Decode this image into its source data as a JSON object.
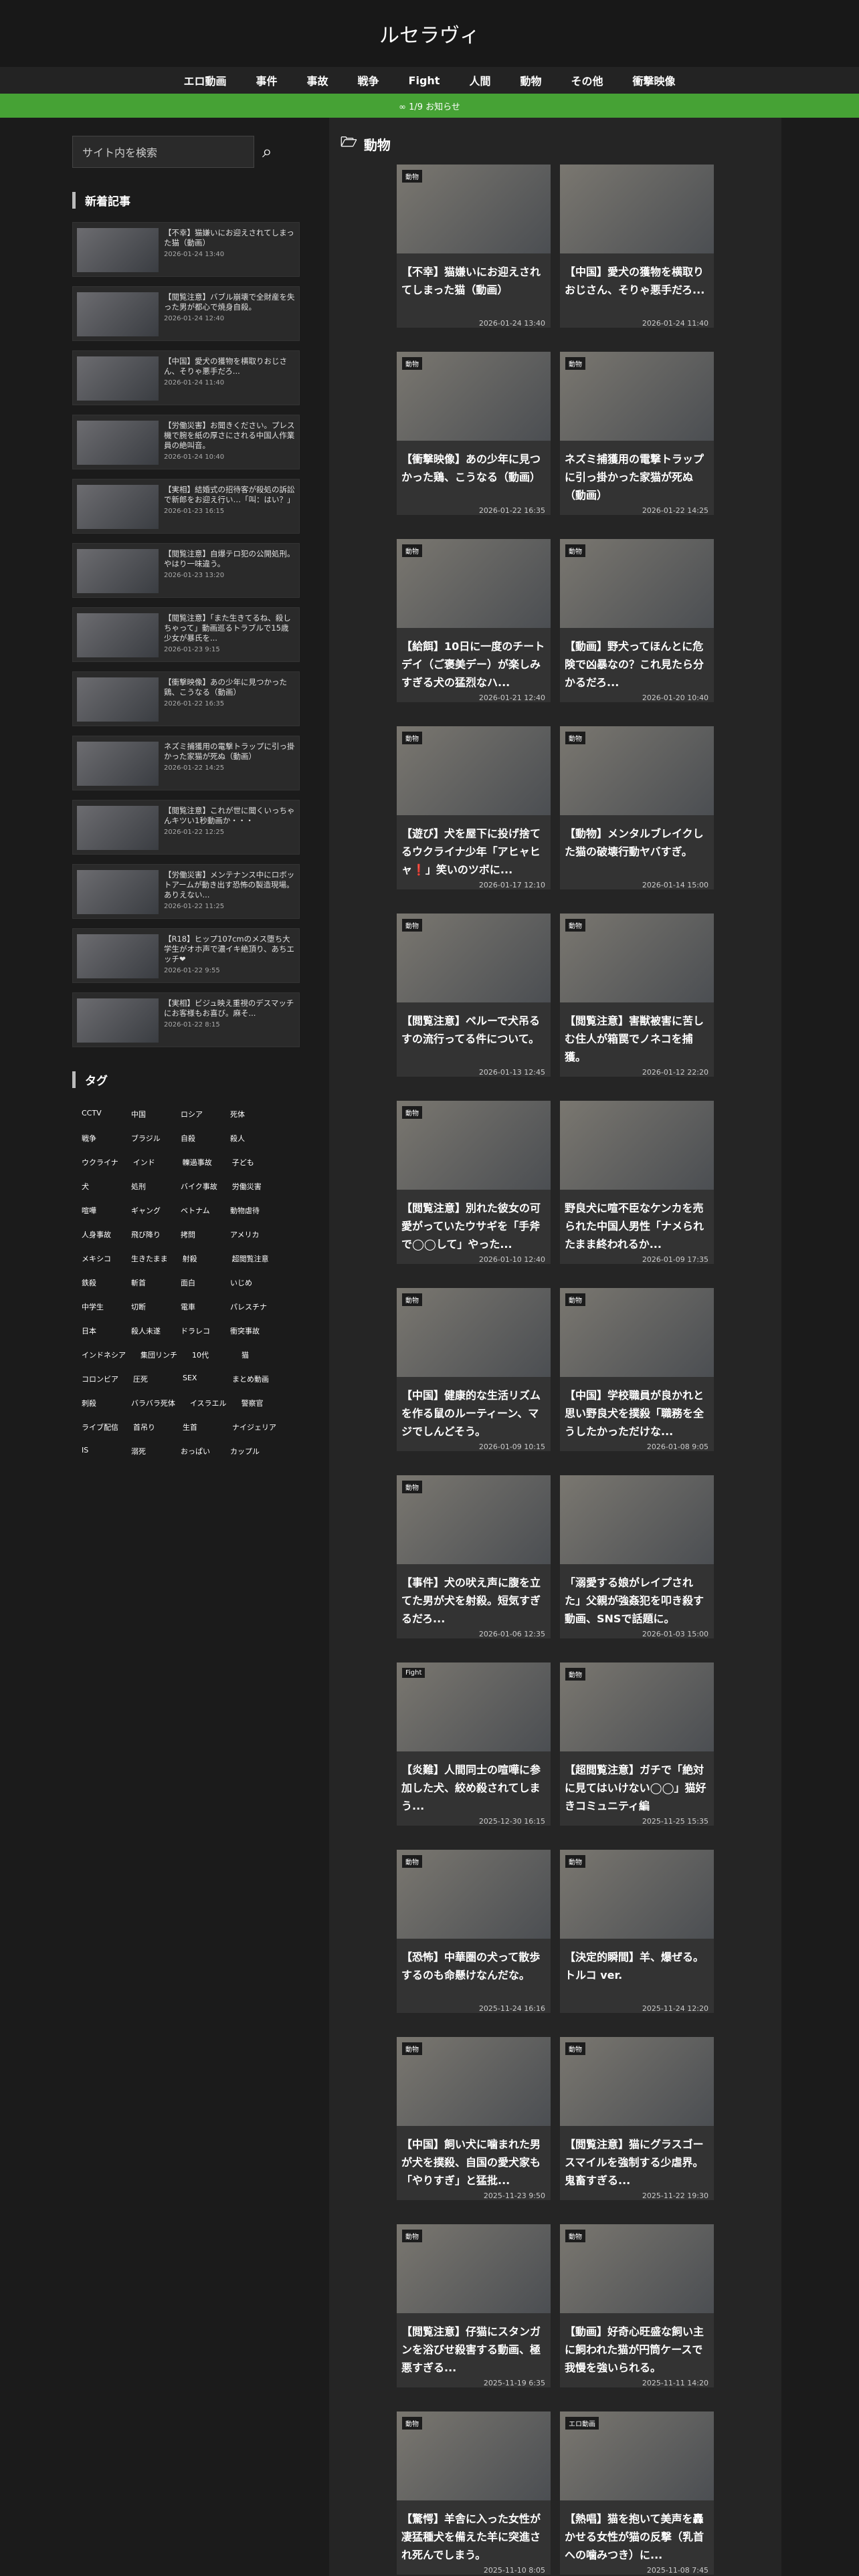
{
  "site": {
    "title": "ルセラヴィ"
  },
  "nav": [
    "エロ動画",
    "事件",
    "事故",
    "戦争",
    "Fight",
    "人間",
    "動物",
    "その他",
    "衝撃映像"
  ],
  "notice": "∞ 1/9 お知らせ",
  "search": {
    "placeholder": "サイト内を検索"
  },
  "sidebar": {
    "recent_heading": "新着記事",
    "tags_heading": "タグ",
    "articles": [
      {
        "t": "【不幸】猫嫌いにお迎えされてしまった猫（動画）",
        "d": "2026-01-24 13:40"
      },
      {
        "t": "【閲覧注意】バブル崩壊で全財産を失った男が都心で焼身自殺。",
        "d": "2026-01-24 12:40"
      },
      {
        "t": "【中国】愛犬の獲物を横取りおじさん、そりゃ悪手だろ...",
        "d": "2026-01-24 11:40"
      },
      {
        "t": "【労働災害】お聞きください。プレス機で腕を紙の厚さにされる中国人作業員の絶叫音。",
        "d": "2026-01-24 10:40"
      },
      {
        "t": "【実相】結婚式の招待客が殺処の訴訟で新郎をお迎え行い…「叫：はい？」",
        "d": "2026-01-23 16:15"
      },
      {
        "t": "【閲覧注意】自爆テロ犯の公開処刑。やはり一味違う。",
        "d": "2026-01-23 13:20"
      },
      {
        "t": "【閲覧注意】「また生きてるね、殺しちゃって」動画巡るトラブルで15歳少女が暴氏を...",
        "d": "2026-01-23 9:15"
      },
      {
        "t": "【衝撃映像】あの少年に見つかった鶏、こうなる（動画）",
        "d": "2026-01-22 16:35"
      },
      {
        "t": "ネズミ捕獲用の電撃トラップに引っ掛かった家猫が死ぬ（動画）",
        "d": "2026-01-22 14:25"
      },
      {
        "t": "【閲覧注意】これが世に聞くいっちゃんキツい1秒動画か・・・",
        "d": "2026-01-22 12:25"
      },
      {
        "t": "【労働災害】メンテナンス中にロボットアームが動き出す恐怖の製造現場。ありえない...",
        "d": "2026-01-22 11:25"
      },
      {
        "t": "【R18】ヒップ107cmのメス堕ち大学生がオホ声で濃イキ絶頂り、あちエッチ❤",
        "d": "2026-01-22 9:55"
      },
      {
        "t": "【実相】ビジュ映え重視のデスマッチにお客様もお喜び。麻そ...",
        "d": "2026-01-22 8:15"
      }
    ],
    "tags": [
      "CCTV",
      "中国",
      "ロシア",
      "死体",
      "戦争",
      "ブラジル",
      "自殺",
      "殺人",
      "ウクライナ",
      "インド",
      "轢過事故",
      "子ども",
      "犬",
      "処刑",
      "バイク事故",
      "労働災害",
      "喧嘩",
      "ギャング",
      "ベトナム",
      "動物虐待",
      "人身事故",
      "飛び降り",
      "拷問",
      "アメリカ",
      "メキシコ",
      "生きたまま",
      "射殺",
      "超閲覧注意",
      "鉄殺",
      "斬首",
      "面白",
      "いじめ",
      "中学生",
      "切断",
      "電車",
      "パレスチナ",
      "日本",
      "殺人未遂",
      "ドラレコ",
      "衝突事故",
      "インドネシア",
      "集団リンチ",
      "10代",
      "猫",
      "コロンビア",
      "圧死",
      "SEX",
      "まとめ動画",
      "刺殺",
      "バラバラ死体",
      "イスラエル",
      "警察官",
      "ライブ配信",
      "首吊り",
      "生首",
      "ナイジェリア",
      "IS",
      "溺死",
      "おっぱい",
      "カップル"
    ]
  },
  "main": {
    "heading": "動物",
    "cards": [
      {
        "c": "動物",
        "t": "【不幸】猫嫌いにお迎えされてしまった猫（動画）",
        "d": "2026-01-24 13:40"
      },
      {
        "c": "",
        "t": "【中国】愛犬の獲物を横取りおじさん、そりゃ悪手だろ...",
        "d": "2026-01-24 11:40"
      },
      {
        "c": "動物",
        "t": "【衝撃映像】あの少年に見つかった鶏、こうなる（動画）",
        "d": "2026-01-22 16:35"
      },
      {
        "c": "動物",
        "t": "ネズミ捕獲用の電撃トラップに引っ掛かった家猫が死ぬ（動画）",
        "d": "2026-01-22 14:25"
      },
      {
        "c": "動物",
        "t": "【給餌】10日に一度のチートデイ（ご褒美デー）が楽しみすぎる犬の猛烈なハ...",
        "d": "2026-01-21 12:40"
      },
      {
        "c": "動物",
        "t": "【動画】野犬ってほんとに危険で凶暴なの？これ見たら分かるだろ...",
        "d": "2026-01-20 10:40"
      },
      {
        "c": "動物",
        "t": "【遊び】犬を屋下に投げ捨てるウクライナ少年「アヒャヒャ❗」笑いのツボに...",
        "d": "2026-01-17 12:10"
      },
      {
        "c": "動物",
        "t": "【動物】メンタルブレイクした猫の破壊行動ヤバすぎ。",
        "d": "2026-01-14 15:00"
      },
      {
        "c": "動物",
        "t": "【閲覧注意】ペルーで犬吊るすの流行ってる件について。",
        "d": "2026-01-13 12:45"
      },
      {
        "c": "動物",
        "t": "【閲覧注意】害獣被害に苦しむ住人が箱罠でノネコを捕獲。",
        "d": "2026-01-12 22:20"
      },
      {
        "c": "動物",
        "t": "【閲覧注意】別れた彼女の可愛がっていたウサギを「手斧で◯◯して」やった...",
        "d": "2026-01-10 12:40"
      },
      {
        "c": "",
        "t": "野良犬に喧不臣なケンカを売られた中国人男性「ナメられたまま終われるか...",
        "d": "2026-01-09 17:35"
      },
      {
        "c": "動物",
        "t": "【中国】健康的な生活リズムを作る鼠のルーティーン、マジでしんどそう。",
        "d": "2026-01-09 10:15"
      },
      {
        "c": "動物",
        "t": "【中国】学校職員が良かれと思い野良犬を撲殺「職務を全うしたかっただけな...",
        "d": "2026-01-08 9:05"
      },
      {
        "c": "動物",
        "t": "【事件】犬の吠え声に腹を立てた男が犬を射殺。短気すぎるだろ...",
        "d": "2026-01-06 12:35"
      },
      {
        "c": "",
        "t": "「溺愛する娘がレイプされた」父親が強姦犯を叩き殺す動画、SNSで話題に。",
        "d": "2026-01-03 15:00"
      },
      {
        "c": "Fight",
        "t": "【炎難】人間同士の喧嘩に参加した犬、絞め殺されてしまう...",
        "d": "2025-12-30 16:15"
      },
      {
        "c": "動物",
        "t": "【超閲覧注意】ガチで「絶対に見てはいけない◯◯」猫好きコミュニティ編",
        "d": "2025-11-25 15:35"
      },
      {
        "c": "動物",
        "t": "【恐怖】中華圏の犬って散歩するのも命懸けなんだな。",
        "d": "2025-11-24 16:16"
      },
      {
        "c": "動物",
        "t": "【決定的瞬間】羊、爆ぜる。トルコ ver.",
        "d": "2025-11-24 12:20"
      },
      {
        "c": "動物",
        "t": "【中国】飼い犬に噛まれた男が犬を撲殺、自国の愛犬家も「やりすぎ」と猛批...",
        "d": "2025-11-23 9:50"
      },
      {
        "c": "動物",
        "t": "【閲覧注意】猫にグラスゴースマイルを強制する少虐界。鬼畜すぎる...",
        "d": "2025-11-22 19:30"
      },
      {
        "c": "動物",
        "t": "【閲覧注意】仔猫にスタンガンを浴びせ殺害する動画、極悪すぎる...",
        "d": "2025-11-19 6:35"
      },
      {
        "c": "動物",
        "t": "【動画】好奇心旺盛な飼い主に飼われた猫が円筒ケースで我慢を強いられる。",
        "d": "2025-11-11 14:20"
      },
      {
        "c": "動物",
        "t": "【驚愕】羊舎に入った女性が凄猛種犬を備えた羊に突進され死んでしまう。",
        "d": "2025-11-10 8:05"
      },
      {
        "c": "エロ動画",
        "t": "【熱唱】猫を抱いて美声を轟かせる女性が猫の反撃（乳首への噛みつき）に...",
        "d": "2025-11-08 7:45"
      }
    ]
  }
}
